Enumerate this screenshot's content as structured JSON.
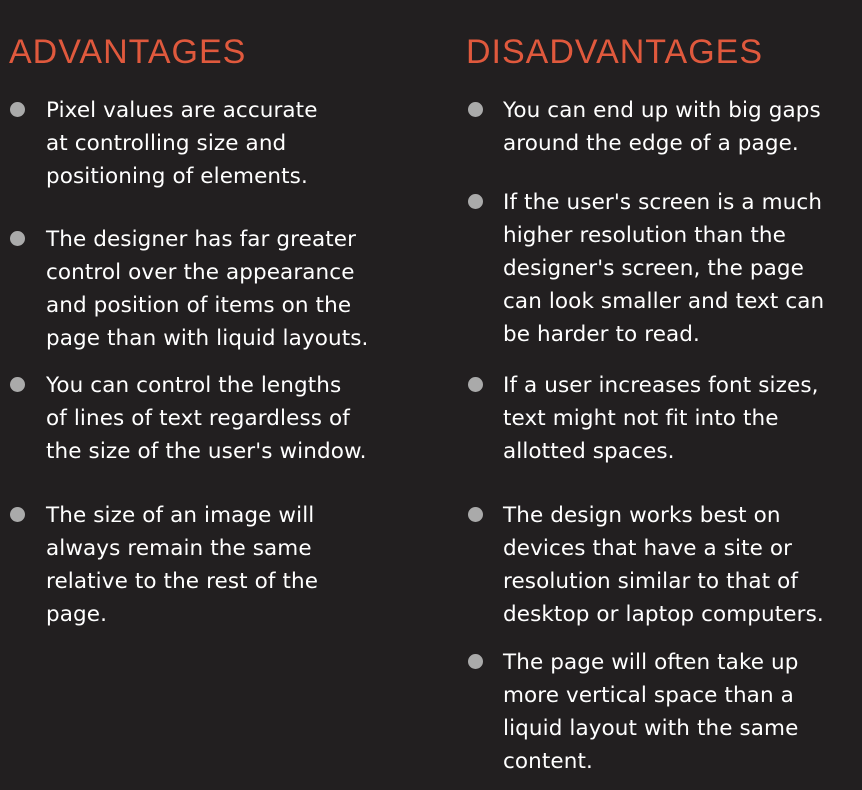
{
  "advantages": {
    "heading": "ADVANTAGES",
    "items": [
      "Pixel values are accurate\nat controlling size and\npositioning of elements.",
      "The designer has far greater\ncontrol over the appearance\nand position of items on the\npage than with liquid layouts.",
      "You can control the lengths\nof lines of text regardless of\nthe size of the user's window.",
      "The size of an image will\nalways remain the same\nrelative to the rest of the\npage."
    ]
  },
  "disadvantages": {
    "heading": "DISADVANTAGES",
    "items": [
      "You can end up with big gaps\naround the edge of a page.",
      "If the user's screen is a much\nhigher resolution than the\ndesigner's screen, the page\ncan look smaller and text can\nbe harder to read.",
      "If a user increases font sizes,\ntext might not fit into the\nallotted spaces.",
      "The design works best on\ndevices that have a site or\nresolution similar to that of\ndesktop or laptop computers.",
      "The page will often take up\nmore vertical space than a\nliquid layout with the same\ncontent."
    ]
  }
}
